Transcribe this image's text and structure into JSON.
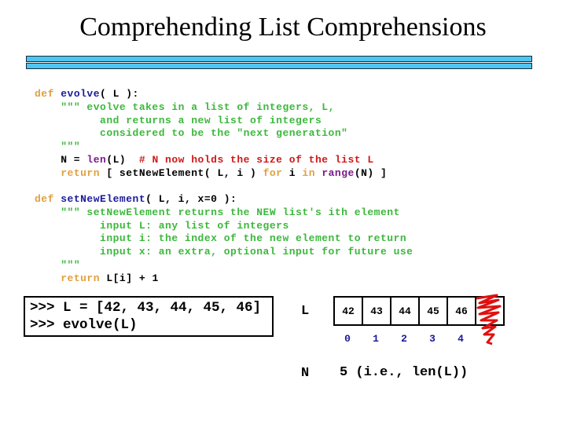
{
  "title": "Comprehending List Comprehensions",
  "colors": {
    "accent_bar": "#4cc6ef",
    "keyword": "#e0a040",
    "function_name": "#1a1a9a",
    "docstring": "#3cb83c",
    "comment": "#d01818",
    "builtin": "#7a1a8a",
    "index": "#1a1a9a",
    "scribble": "#e01010"
  },
  "code_blocks": [
    [
      [
        [
          "kw",
          "def "
        ],
        [
          "fn",
          "evolve"
        ],
        [
          "pl",
          "( L ):"
        ]
      ],
      [
        [
          "pl",
          "    "
        ],
        [
          "doc",
          "\"\"\" evolve takes in a list of integers, L,"
        ]
      ],
      [
        [
          "doc",
          "          and returns a new list of integers"
        ]
      ],
      [
        [
          "doc",
          "          considered to be the \"next generation\""
        ]
      ],
      [
        [
          "pl",
          "    "
        ],
        [
          "doc",
          "\"\"\""
        ]
      ],
      [
        [
          "pl",
          "    N = "
        ],
        [
          "bi",
          "len"
        ],
        [
          "pl",
          "(L)  "
        ],
        [
          "cm",
          "# N now holds the size of the list L"
        ]
      ],
      [
        [
          "pl",
          "    "
        ],
        [
          "kw",
          "return"
        ],
        [
          "pl",
          " [ setNewElement( L, i ) "
        ],
        [
          "kw",
          "for"
        ],
        [
          "pl",
          " i "
        ],
        [
          "kw",
          "in"
        ],
        [
          "pl",
          " "
        ],
        [
          "bi",
          "range"
        ],
        [
          "pl",
          "(N) ]"
        ]
      ]
    ],
    [
      [
        [
          "kw",
          "def "
        ],
        [
          "fn",
          "setNewElement"
        ],
        [
          "pl",
          "( L, i, x=0 ):"
        ]
      ],
      [
        [
          "pl",
          "    "
        ],
        [
          "doc",
          "\"\"\" setNewElement returns the NEW list's ith element"
        ]
      ],
      [
        [
          "doc",
          "          input L: any list of integers"
        ]
      ],
      [
        [
          "doc",
          "          input i: the index of the new element to return"
        ]
      ],
      [
        [
          "doc",
          "          input x: an extra, optional input for future use"
        ]
      ],
      [
        [
          "pl",
          "    "
        ],
        [
          "doc",
          "\"\"\""
        ]
      ],
      [
        [
          "pl",
          "    "
        ],
        [
          "kw",
          "return"
        ],
        [
          "pl",
          " L[i] + 1"
        ]
      ]
    ]
  ],
  "repl": {
    "line1": ">>> L = [42, 43, 44, 45, 46]",
    "line2": ">>> evolve(L)"
  },
  "list_diagram": {
    "label": "L",
    "values": [
      "42",
      "43",
      "44",
      "45",
      "46",
      ""
    ],
    "indices": [
      "0",
      "1",
      "2",
      "3",
      "4"
    ],
    "scribbled_cell_icon": "red-scribble",
    "n_label": "N",
    "n_value": "5 (i.e., len(L))"
  }
}
